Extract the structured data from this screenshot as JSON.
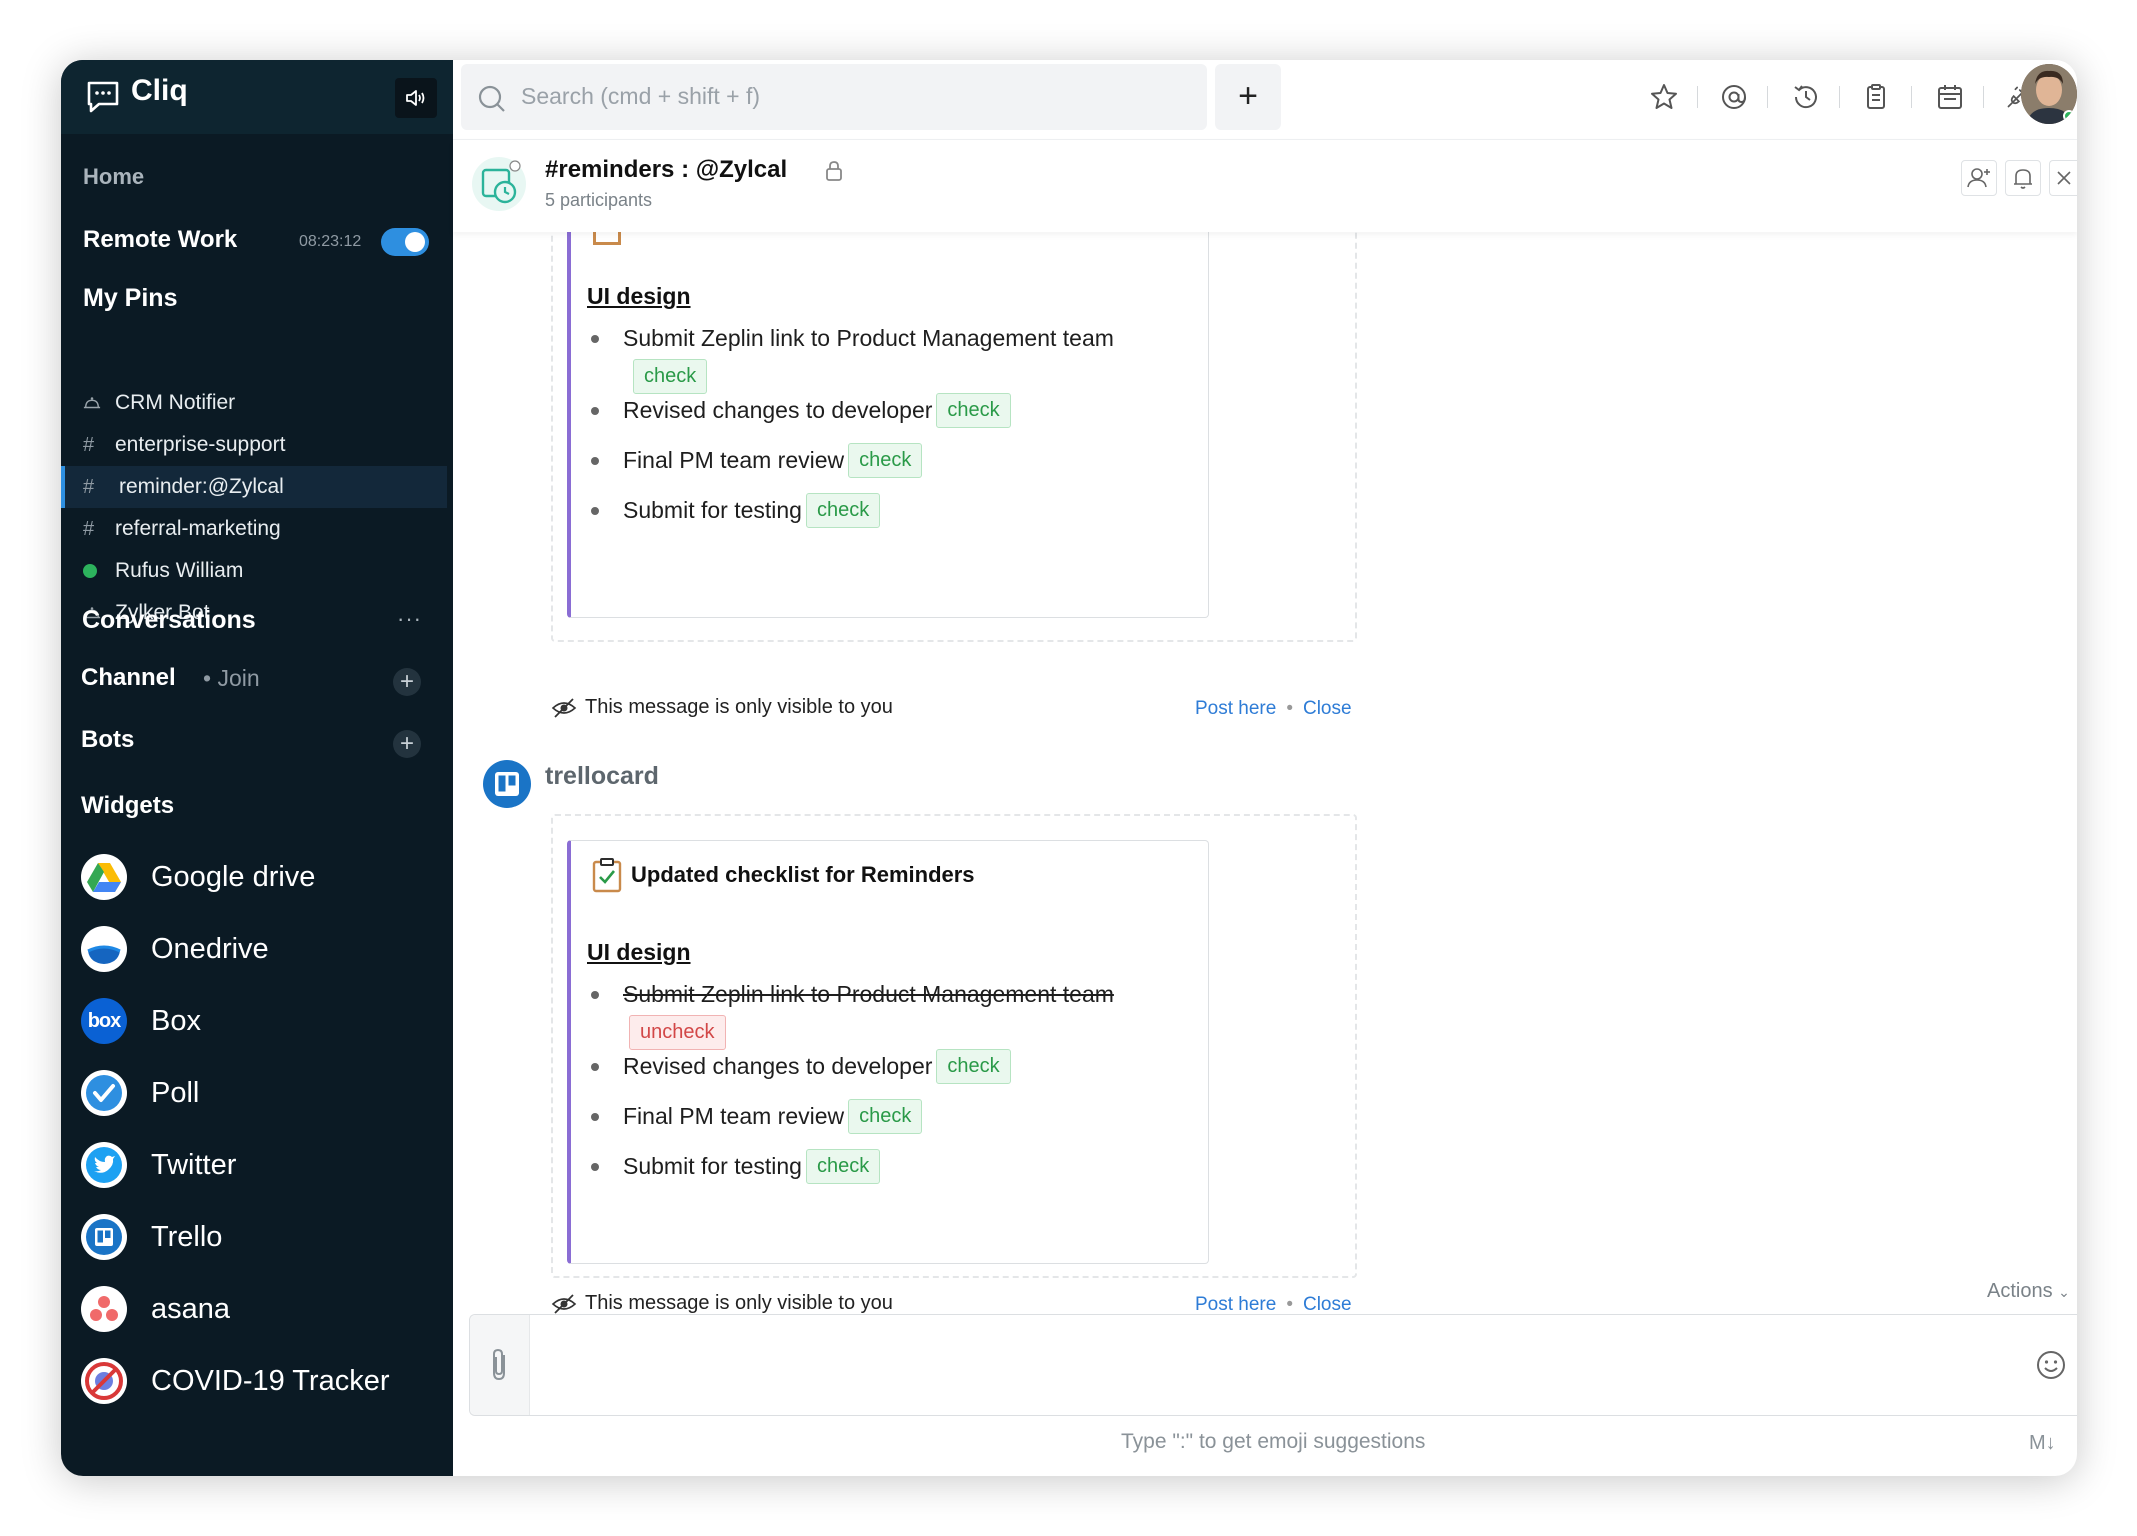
{
  "app": {
    "name": "Cliq"
  },
  "sidebar": {
    "home": "Home",
    "remote_work": {
      "label": "Remote Work",
      "time": "08:23:12",
      "enabled": true
    },
    "pins_title": "My Pins",
    "pins": [
      {
        "label": "CRM Notifier",
        "icon": "bot-icon"
      },
      {
        "label": "enterprise-support",
        "icon": "hash-icon"
      },
      {
        "label": "reminder:@Zylcal",
        "icon": "hash-icon",
        "active": true
      },
      {
        "label": "referral-marketing",
        "icon": "hash-icon"
      },
      {
        "label": "Rufus William",
        "icon": "online-dot-icon"
      },
      {
        "label": "Zylker Bot",
        "icon": "bot-icon"
      }
    ],
    "conversations": "Conversations",
    "conversations_more": "···",
    "channel": "Channel",
    "channel_join": "• Join",
    "bots": "Bots",
    "widgets_title": "Widgets",
    "widgets": [
      {
        "label": "Google drive",
        "icon": "google-drive-icon"
      },
      {
        "label": "Onedrive",
        "icon": "onedrive-icon"
      },
      {
        "label": "Box",
        "icon": "box-icon",
        "logo_text": "box"
      },
      {
        "label": "Poll",
        "icon": "poll-icon"
      },
      {
        "label": "Twitter",
        "icon": "twitter-icon"
      },
      {
        "label": "Trello",
        "icon": "trello-icon"
      },
      {
        "label": "asana",
        "icon": "asana-icon"
      },
      {
        "label": "COVID-19 Tracker",
        "icon": "covid-tracker-icon"
      }
    ]
  },
  "topbar": {
    "search_placeholder": "Search (cmd + shift + f)",
    "add": "+",
    "icons": [
      "star-icon",
      "at-mention-icon",
      "history-icon",
      "clipboard-icon",
      "calendar-icon",
      "plug-icon"
    ]
  },
  "channel": {
    "title": "#reminders : @Zylcal",
    "participants": "5 participants"
  },
  "messages": [
    {
      "section": "UI design",
      "tasks": [
        {
          "text": "Submit Zeplin link to Product Management team",
          "action": "check"
        },
        {
          "text": "Revised changes to developer",
          "action": "check"
        },
        {
          "text": "Final PM team review",
          "action": "check"
        },
        {
          "text": "Submit for testing",
          "action": "check"
        }
      ],
      "note": "This message is only visible to you",
      "post_here": "Post here",
      "close": "Close"
    },
    {
      "sender": "trellocard",
      "card_title": "Updated checklist for Reminders",
      "section": "UI design",
      "tasks": [
        {
          "text": "Submit Zeplin link to Product Management team",
          "action": "uncheck",
          "done": true
        },
        {
          "text": "Revised changes to developer",
          "action": "check"
        },
        {
          "text": "Final PM team review",
          "action": "check"
        },
        {
          "text": "Submit for testing",
          "action": "check"
        }
      ],
      "note": "This message is only visible to you",
      "post_here": "Post here",
      "close": "Close"
    }
  ],
  "composer": {
    "actions": "Actions",
    "hint": "Type \":\" to get emoji suggestions",
    "markdown": "M↓"
  },
  "colors": {
    "sidebar_bg": "#0b1a24",
    "accent": "#2e8fe0",
    "check_green": "#2a9a48",
    "uncheck_red": "#d24747",
    "card_border": "#8a6dd4"
  }
}
